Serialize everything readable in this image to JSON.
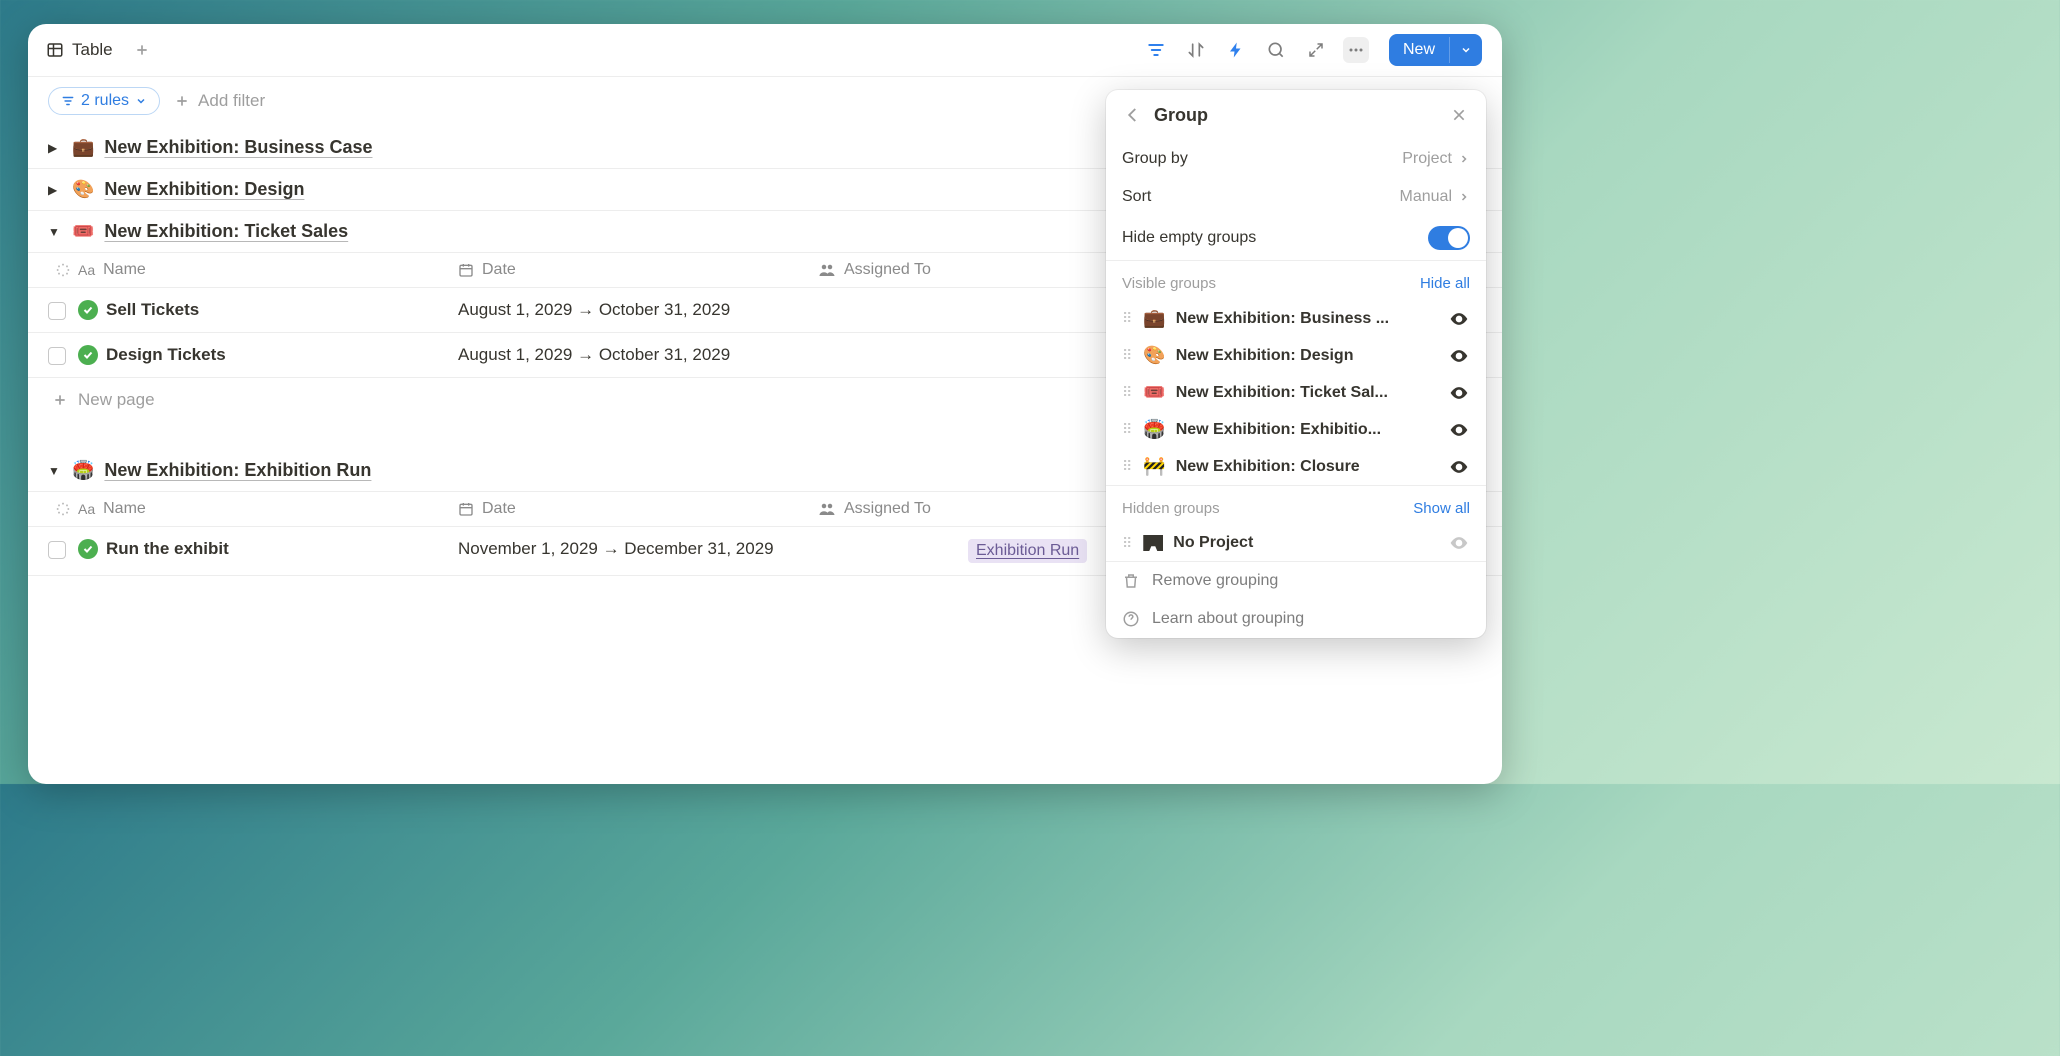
{
  "topbar": {
    "tab_label": "Table",
    "new_button": "New"
  },
  "filters": {
    "rules_label": "2 rules",
    "add_filter": "Add filter"
  },
  "columns": {
    "name": "Name",
    "date": "Date",
    "assigned": "Assigned To"
  },
  "groups": [
    {
      "emoji": "💼",
      "title": "New Exhibition: Business Case",
      "expanded": false
    },
    {
      "emoji": "🎨",
      "title": "New Exhibition: Design",
      "expanded": false
    },
    {
      "emoji": "🎟️",
      "title": "New Exhibition: Ticket Sales",
      "expanded": true,
      "rows": [
        {
          "name": "Sell Tickets",
          "date": "August 1, 2029 → October 31, 2029"
        },
        {
          "name": "Design Tickets",
          "date": "August 1, 2029 → October 31, 2029"
        }
      ]
    },
    {
      "emoji": "🏟️",
      "title": "New Exhibition: Exhibition Run",
      "expanded": true,
      "rows": [
        {
          "name": "Run the exhibit",
          "date": "November 1, 2029 → December 31, 2029",
          "project_tag": "Exhibition Run"
        }
      ]
    }
  ],
  "new_page": "New page",
  "popover": {
    "title": "Group",
    "group_by_label": "Group by",
    "group_by_value": "Project",
    "sort_label": "Sort",
    "sort_value": "Manual",
    "hide_empty_label": "Hide empty groups",
    "visible_label": "Visible groups",
    "hide_all": "Hide all",
    "visible_groups": [
      {
        "emoji": "💼",
        "title": "New Exhibition: Business ..."
      },
      {
        "emoji": "🎨",
        "title": "New Exhibition: Design"
      },
      {
        "emoji": "🎟️",
        "title": "New Exhibition: Ticket Sal..."
      },
      {
        "emoji": "🏟️",
        "title": "New Exhibition: Exhibitio..."
      },
      {
        "emoji": "🚧",
        "title": "New Exhibition: Closure"
      }
    ],
    "hidden_label": "Hidden groups",
    "show_all": "Show all",
    "hidden_groups": [
      {
        "title": "No Project"
      }
    ],
    "remove_grouping": "Remove grouping",
    "learn": "Learn about grouping"
  }
}
